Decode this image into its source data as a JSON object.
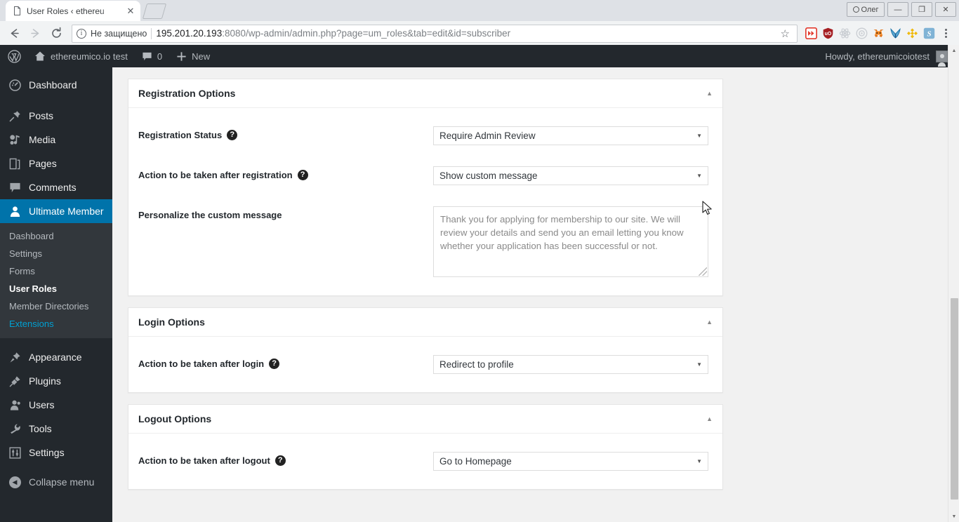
{
  "browser": {
    "tab": {
      "title": "User Roles ‹ ethereu",
      "favicon_name": "page-icon",
      "close_label": "✕"
    },
    "newtab_label": "",
    "window_controls": {
      "profile_label": "Олег",
      "minimize_label": "—",
      "maximize_label": "❐",
      "close_label": "✕"
    },
    "nav": {
      "back_label": "←",
      "forward_label": "→",
      "reload_label": "⟳"
    },
    "omnibox": {
      "info_glyph": "i",
      "security_label": "Не защищено",
      "url_host": "195.201.20.193",
      "url_rest": ":8080/wp-admin/admin.php?page=um_roles&tab=edit&id=subscriber",
      "bookmark_label": "☆"
    },
    "extensions": [
      {
        "name": "video-downloader-extension",
        "label": "▶▶",
        "color": "#e23b2e"
      },
      {
        "name": "shield-extension",
        "label": "uO",
        "color": "#a51e22"
      },
      {
        "name": "atom-extension",
        "label": "⚛",
        "color": "#c9cdd2"
      },
      {
        "name": "target-extension",
        "label": "◎",
        "color": "#c9cdd2"
      },
      {
        "name": "metamask-extension",
        "label": "🦊",
        "color": "#e2761b"
      },
      {
        "name": "yandex-extension",
        "label": "Y",
        "color": "#1a73a8"
      },
      {
        "name": "binance-extension",
        "label": "◆",
        "color": "#f0b90b"
      },
      {
        "name": "script-extension",
        "label": "S",
        "color": "#7fb3d5"
      }
    ],
    "menu_label": "⋮"
  },
  "adminbar": {
    "logo_name": "wordpress-logo",
    "site_name": "ethereumico.io test",
    "comment_count": "0",
    "new_label": "New",
    "howdy": "Howdy, ethereumicoiotest"
  },
  "sidebar": {
    "items": [
      {
        "label": "Dashboard",
        "icon": "dashboard-icon",
        "current": false
      },
      {
        "label": "Posts",
        "icon": "pin-icon",
        "current": false
      },
      {
        "label": "Media",
        "icon": "media-icon",
        "current": false
      },
      {
        "label": "Pages",
        "icon": "pages-icon",
        "current": false
      },
      {
        "label": "Comments",
        "icon": "comment-icon",
        "current": false
      },
      {
        "label": "Ultimate Member",
        "icon": "user-icon",
        "current": true
      },
      {
        "label": "Appearance",
        "icon": "brush-icon",
        "current": false
      },
      {
        "label": "Plugins",
        "icon": "plug-icon",
        "current": false
      },
      {
        "label": "Users",
        "icon": "users-icon",
        "current": false
      },
      {
        "label": "Tools",
        "icon": "wrench-icon",
        "current": false
      },
      {
        "label": "Settings",
        "icon": "sliders-icon",
        "current": false
      }
    ],
    "submenu": [
      {
        "label": "Dashboard",
        "state": "normal"
      },
      {
        "label": "Settings",
        "state": "normal"
      },
      {
        "label": "Forms",
        "state": "normal"
      },
      {
        "label": "User Roles",
        "state": "active"
      },
      {
        "label": "Member Directories",
        "state": "normal"
      },
      {
        "label": "Extensions",
        "state": "link"
      }
    ],
    "collapse_label": "Collapse menu",
    "collapse_icon": "collapse-arrow-icon"
  },
  "main": {
    "panels": [
      {
        "title": "Registration Options",
        "toggle_icon": "caret-up-icon",
        "toggle_glyph": "▲",
        "fields": [
          {
            "label": "Registration Status",
            "has_help": true,
            "type": "select",
            "value": "Require Admin Review",
            "caret": "▼"
          },
          {
            "label": "Action to be taken after registration",
            "has_help": true,
            "type": "select",
            "value": "Show custom message",
            "caret": "▼"
          },
          {
            "label": "Personalize the custom message",
            "has_help": false,
            "type": "textarea",
            "value": "Thank you for applying for membership to our site. We will review your details and send you an email letting you know whether your application has been successful or not."
          }
        ]
      },
      {
        "title": "Login Options",
        "toggle_icon": "caret-up-icon",
        "toggle_glyph": "▲",
        "fields": [
          {
            "label": "Action to be taken after login",
            "has_help": true,
            "type": "select",
            "value": "Redirect to profile",
            "caret": "▼"
          }
        ]
      },
      {
        "title": "Logout Options",
        "toggle_icon": "caret-up-icon",
        "toggle_glyph": "▲",
        "fields": [
          {
            "label": "Action to be taken after logout",
            "has_help": true,
            "type": "select",
            "value": "Go to Homepage",
            "caret": "▼"
          }
        ]
      }
    ]
  },
  "scrollbar": {
    "up_glyph": "▲",
    "down_glyph": "▼"
  },
  "colors": {
    "wp_dark": "#23282d",
    "wp_blue": "#0073aa",
    "wp_link": "#00a0d2",
    "page_bg": "#f1f1f1"
  }
}
